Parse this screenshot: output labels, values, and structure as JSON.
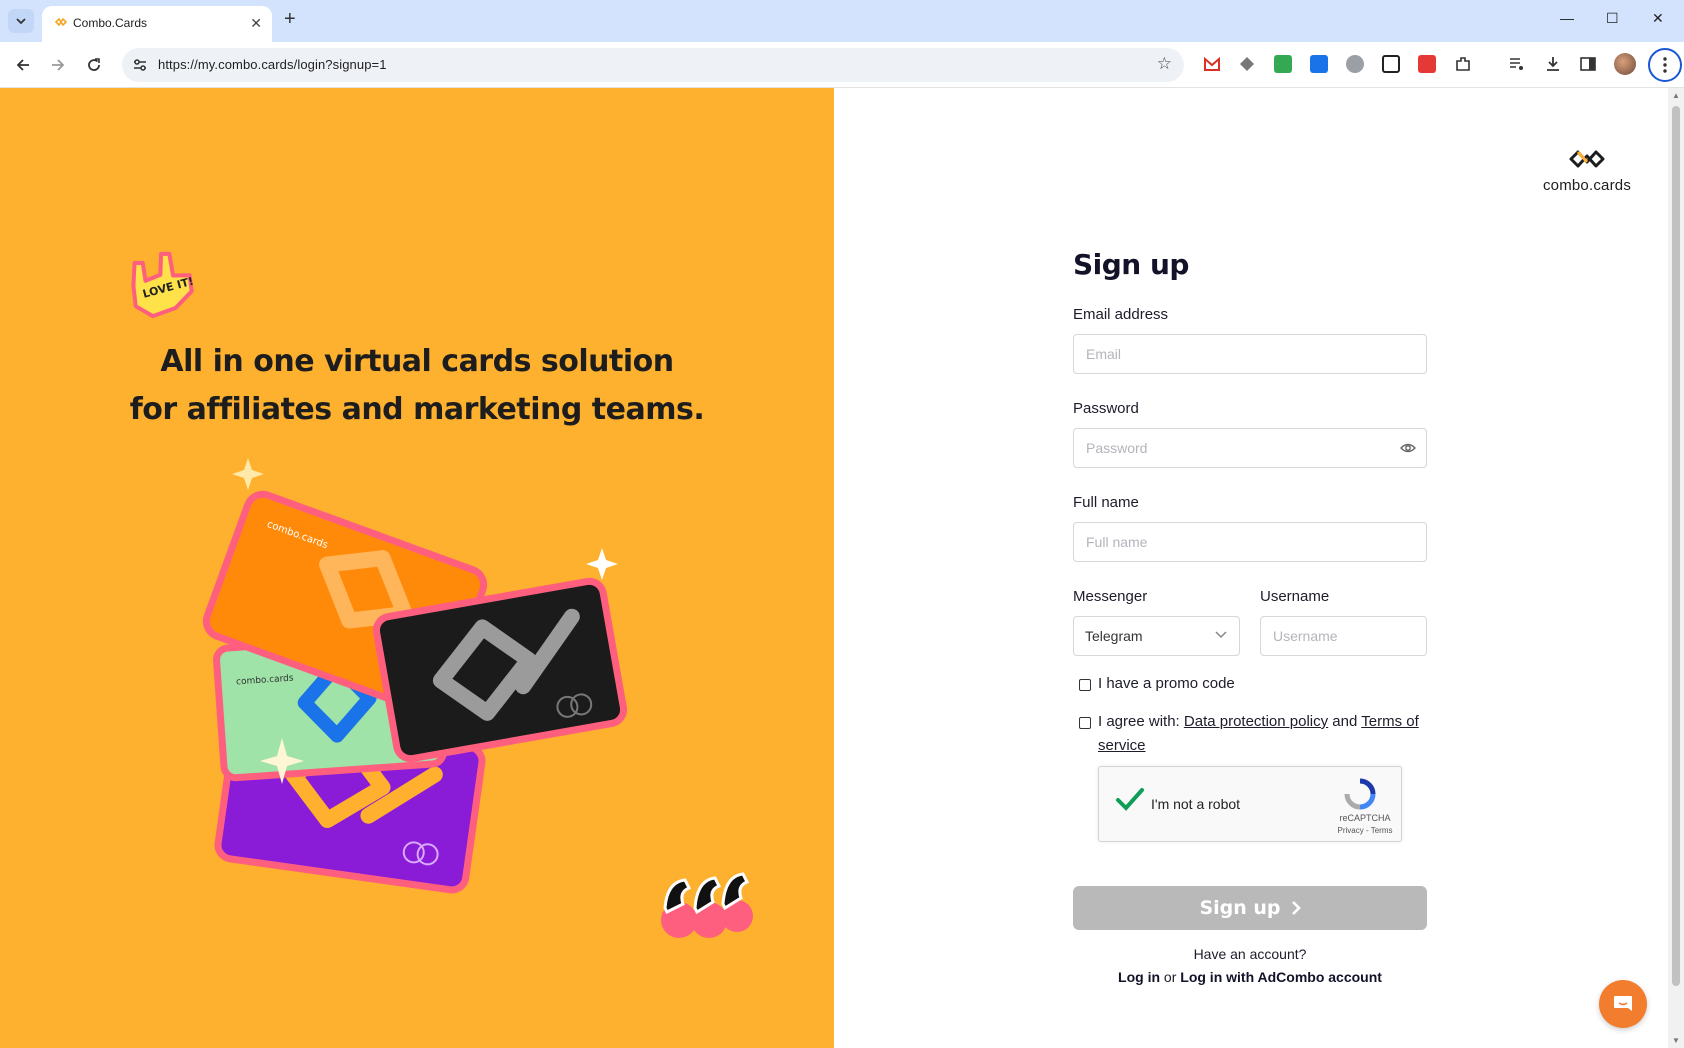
{
  "browser": {
    "tab_title": "Combo.Cards",
    "url": "https://my.combo.cards/login?signup=1",
    "tab_close": "✕",
    "new_tab": "+",
    "win_min": "—",
    "win_max": "☐",
    "win_close": "✕"
  },
  "hero": {
    "headline_line1": "All in one virtual cards solution",
    "headline_line2": "for affiliates and marketing teams.",
    "sticker_text": "LOVE IT!",
    "card_brand": "combo.cards"
  },
  "logo": {
    "word": "combo.cards"
  },
  "form": {
    "title": "Sign up",
    "email_label": "Email address",
    "email_placeholder": "Email",
    "password_label": "Password",
    "password_placeholder": "Password",
    "fullname_label": "Full name",
    "fullname_placeholder": "Full name",
    "messenger_label": "Messenger",
    "messenger_value": "Telegram",
    "username_label": "Username",
    "username_placeholder": "Username",
    "promo_label": "I have a promo code",
    "agree_prefix": "I agree with: ",
    "data_policy": "Data protection policy",
    "and": " and ",
    "terms": "Terms of service",
    "captcha_text": "I'm not a robot",
    "captcha_brand": "reCAPTCHA",
    "captcha_links": "Privacy - Terms",
    "submit": "Sign up",
    "have_account": "Have an account?",
    "login": "Log in",
    "or": " or ",
    "login_adcombo": "Log in with AdCombo account"
  },
  "colors": {
    "accent": "#feb02f",
    "button_disabled": "#b9b9b9",
    "chat": "#f27d2e"
  }
}
